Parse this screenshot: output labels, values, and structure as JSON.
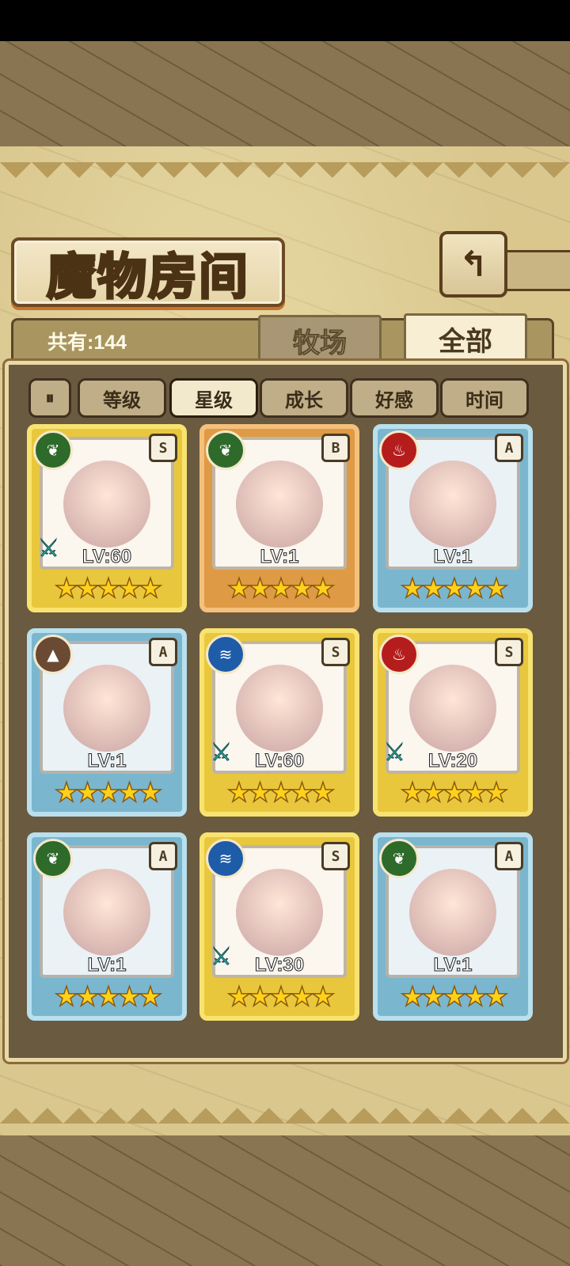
{
  "header": {
    "title": "魔物房间",
    "back_icon": "back-arrow-icon"
  },
  "summary": {
    "count_text": "共有:144"
  },
  "tabs": [
    {
      "label": "牧场",
      "active": false
    },
    {
      "label": "全部",
      "active": true
    }
  ],
  "sort": {
    "toggle_label": "⏸",
    "options": [
      {
        "label": "等级",
        "selected": false
      },
      {
        "label": "星级",
        "selected": true
      },
      {
        "label": "成长",
        "selected": false
      },
      {
        "label": "好感",
        "selected": false
      },
      {
        "label": "时间",
        "selected": false
      }
    ]
  },
  "monsters": [
    {
      "level": "LV:60",
      "rank": "S",
      "element": "leaf",
      "frame": "gold",
      "stars": 5,
      "weapon": true
    },
    {
      "level": "LV:1",
      "rank": "B",
      "element": "leaf",
      "frame": "bronze",
      "stars": 5,
      "weapon": false
    },
    {
      "level": "LV:1",
      "rank": "A",
      "element": "fire",
      "frame": "blue",
      "stars": 5,
      "weapon": false
    },
    {
      "level": "LV:1",
      "rank": "A",
      "element": "earth",
      "frame": "blue",
      "stars": 5,
      "weapon": false
    },
    {
      "level": "LV:60",
      "rank": "S",
      "element": "water",
      "frame": "gold",
      "stars": 5,
      "weapon": true
    },
    {
      "level": "LV:20",
      "rank": "S",
      "element": "fire",
      "frame": "gold",
      "stars": 5,
      "weapon": true
    },
    {
      "level": "LV:1",
      "rank": "A",
      "element": "leaf",
      "frame": "blue",
      "stars": 5,
      "weapon": false
    },
    {
      "level": "LV:30",
      "rank": "S",
      "element": "water",
      "frame": "gold",
      "stars": 5,
      "weapon": true
    },
    {
      "level": "LV:1",
      "rank": "A",
      "element": "leaf",
      "frame": "blue",
      "stars": 5,
      "weapon": false
    }
  ],
  "colors": {
    "panel": "#d9c78e",
    "gold_frame": "#e9c73d",
    "blue_frame": "#7bb6cf",
    "bronze_frame": "#de9a45",
    "star": "#ffd11a"
  }
}
